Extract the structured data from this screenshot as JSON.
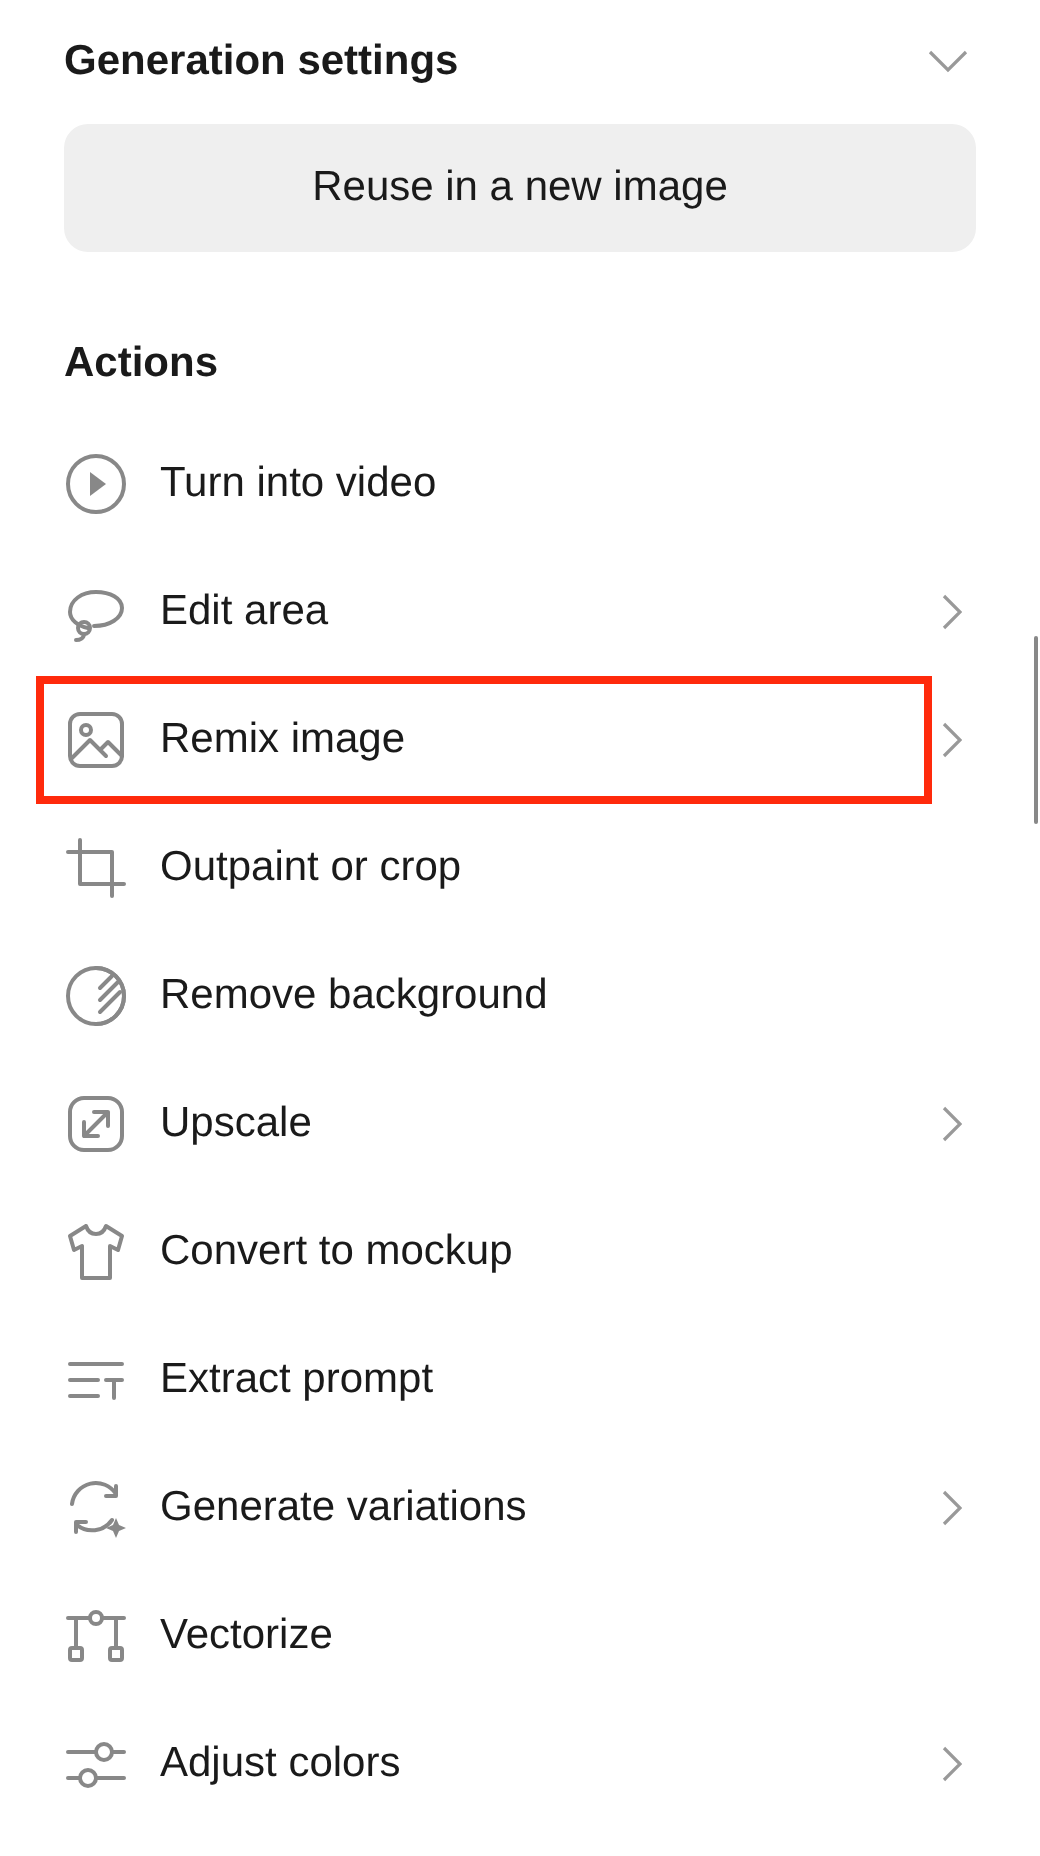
{
  "generation_settings": {
    "title": "Generation settings",
    "expanded": false,
    "button": "Reuse in a new image"
  },
  "actions": {
    "title": "Actions",
    "items": [
      {
        "kind": "play",
        "label": "Turn into video",
        "submenu": false,
        "highlighted": false
      },
      {
        "kind": "lasso",
        "label": "Edit area",
        "submenu": true,
        "highlighted": false
      },
      {
        "kind": "image",
        "label": "Remix image",
        "submenu": true,
        "highlighted": true
      },
      {
        "kind": "crop",
        "label": "Outpaint or crop",
        "submenu": false,
        "highlighted": false
      },
      {
        "kind": "stripes",
        "label": "Remove background",
        "submenu": false,
        "highlighted": false
      },
      {
        "kind": "expand",
        "label": "Upscale",
        "submenu": true,
        "highlighted": false
      },
      {
        "kind": "shirt",
        "label": "Convert to mockup",
        "submenu": false,
        "highlighted": false
      },
      {
        "kind": "text",
        "label": "Extract prompt",
        "submenu": false,
        "highlighted": false
      },
      {
        "kind": "cycle",
        "label": "Generate variations",
        "submenu": true,
        "highlighted": false
      },
      {
        "kind": "vector",
        "label": "Vectorize",
        "submenu": false,
        "highlighted": false
      },
      {
        "kind": "sliders",
        "label": "Adjust colors",
        "submenu": true,
        "highlighted": false
      }
    ]
  }
}
